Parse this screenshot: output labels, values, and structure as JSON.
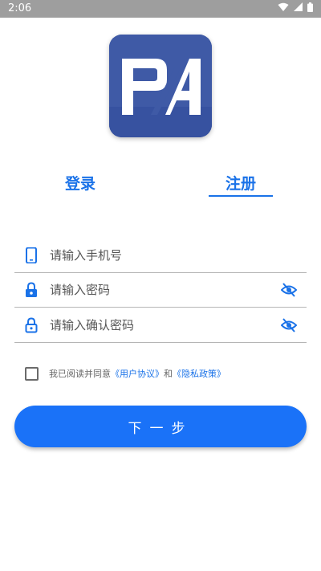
{
  "status_bar": {
    "time": "2:06"
  },
  "logo": {
    "text": "PA"
  },
  "tabs": {
    "login": "登录",
    "register": "注册"
  },
  "form": {
    "phone_placeholder": "请输入手机号",
    "password_placeholder": "请输入密码",
    "confirm_placeholder": "请输入确认密码"
  },
  "agreement": {
    "prefix": "我已阅读并同意",
    "user_agreement": "《用户协议》",
    "and": "和",
    "privacy_policy": "《隐私政策》",
    "checked": false
  },
  "next_button": {
    "label": "下一步"
  },
  "colors": {
    "accent": "#1a72e8",
    "button": "#1a72f8",
    "logo_bg": "#3f5aa6",
    "status_bar": "#9e9e9e"
  }
}
